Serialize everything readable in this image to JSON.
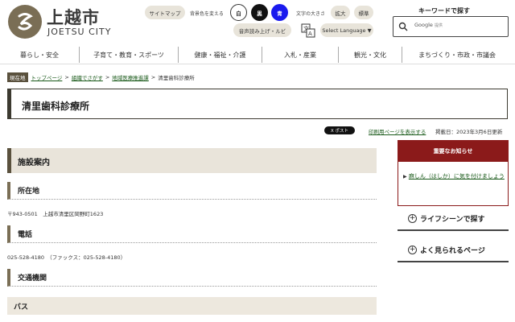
{
  "header": {
    "logo_name": "上越市",
    "logo_roman": "JOETSU CITY",
    "sitemap": "サイトマップ",
    "bg_color_label": "背景色を変える",
    "bg_white": "白",
    "bg_black": "黒",
    "bg_blue": "青",
    "font_size_label": "文字の大きさ",
    "font_enlarge": "拡大",
    "font_standard": "標準",
    "voice_ruby": "音声読み上げ・ルビ",
    "select_language": "Select Language ▼",
    "keyword_title": "キーワードで探す",
    "search_placeholder": "Google",
    "search_sub": "提供"
  },
  "nav": {
    "items": [
      "暮らし・安全",
      "子育て・教育・スポーツ",
      "健康・福祉・介護",
      "入札・産業",
      "観光・文化",
      "まちづくり・市政・市議会"
    ]
  },
  "breadcrumb": {
    "here": "現在地",
    "items": [
      "トップページ",
      "組織でさがす",
      "地域医療推進課"
    ],
    "current": "清里歯科診療所",
    "sep": ">"
  },
  "page": {
    "title": "清里歯科診療所",
    "post": "X ポスト",
    "print": "印刷用ページを表示する",
    "published": "掲載日：2023年3月6日更新"
  },
  "main": {
    "h2": "施設案内",
    "location_h": "所在地",
    "location_text": "〒943-0501　上越市清里区岡野町1623",
    "phone_h": "電話",
    "phone_text": "025-528-4180　（ファックス：025-528-4180）",
    "access_h": "交通機関",
    "bus_h": "バス"
  },
  "sidebar": {
    "notice_title": "重要なお知らせ",
    "notice_item": "麻しん（はしか）に気を付けましょう",
    "lifescene": "ライフシーンで探す",
    "popular": "よく見られるページ"
  },
  "colors": {
    "brand": "#7a6e55",
    "notice": "#8b1a1a",
    "blue_bg": "#1a1aee"
  }
}
